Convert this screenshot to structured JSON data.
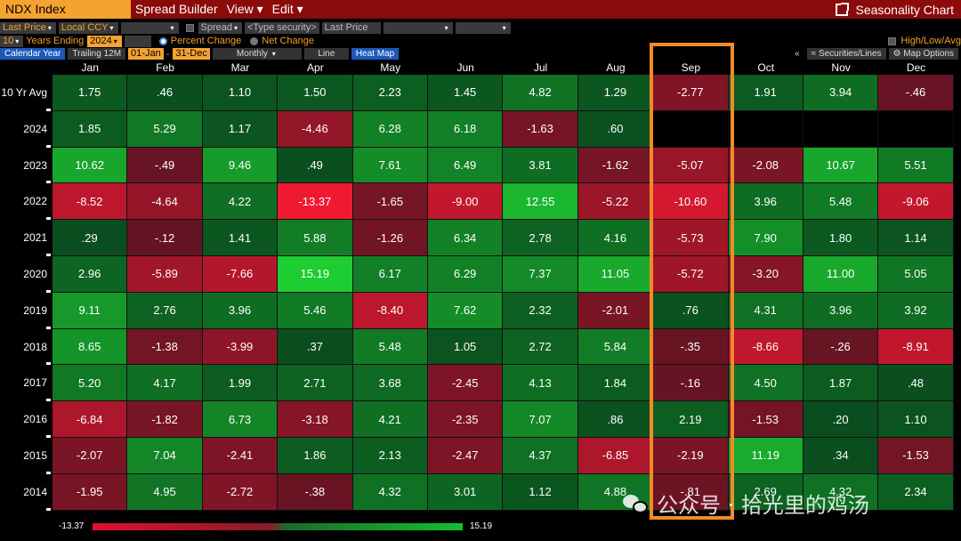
{
  "titlebar": {
    "ticker": "NDX Index",
    "menus": [
      "Spread Builder",
      "View ▾",
      "Edit ▾"
    ],
    "title": "Seasonality Chart"
  },
  "options": {
    "price_field": "Last Price",
    "currency": "Local CCY",
    "spread_label": "Spread",
    "security_placeholder": "<Type security>",
    "second_price": "Last Price",
    "years": "10",
    "years_label": "Years Ending",
    "end_year": "2024",
    "percent_change": "Percent Change",
    "net_change": "Net Change",
    "high_low_avg": "High/Low/Avg"
  },
  "toolbar": {
    "calendar_year": "Calendar Year",
    "trailing": "Trailing 12M",
    "start": "01-Jan",
    "dash": "-",
    "end": "31-Dec",
    "frequency": "Monthly",
    "line": "Line",
    "heat_map": "Heat Map",
    "collapse": "«",
    "securities_lines": "Securities/Lines",
    "map_options": "Map Options"
  },
  "months": [
    "Jan",
    "Feb",
    "Mar",
    "Apr",
    "May",
    "Jun",
    "Jul",
    "Aug",
    "Sep",
    "Oct",
    "Nov",
    "Dec"
  ],
  "rows": [
    {
      "label": "10 Yr Avg",
      "values": [
        "1.75",
        ".46",
        "1.10",
        "1.50",
        "2.23",
        "1.45",
        "4.82",
        "1.29",
        "-2.77",
        "1.91",
        "3.94",
        "-.46"
      ]
    },
    {
      "label": "2024",
      "values": [
        "1.85",
        "5.29",
        "1.17",
        "-4.46",
        "6.28",
        "6.18",
        "-1.63",
        ".60",
        "",
        "",
        "",
        ""
      ]
    },
    {
      "label": "2023",
      "values": [
        "10.62",
        "-.49",
        "9.46",
        ".49",
        "7.61",
        "6.49",
        "3.81",
        "-1.62",
        "-5.07",
        "-2.08",
        "10.67",
        "5.51"
      ]
    },
    {
      "label": "2022",
      "values": [
        "-8.52",
        "-4.64",
        "4.22",
        "-13.37",
        "-1.65",
        "-9.00",
        "12.55",
        "-5.22",
        "-10.60",
        "3.96",
        "5.48",
        "-9.06"
      ]
    },
    {
      "label": "2021",
      "values": [
        ".29",
        "-.12",
        "1.41",
        "5.88",
        "-1.26",
        "6.34",
        "2.78",
        "4.16",
        "-5.73",
        "7.90",
        "1.80",
        "1.14"
      ]
    },
    {
      "label": "2020",
      "values": [
        "2.96",
        "-5.89",
        "-7.66",
        "15.19",
        "6.17",
        "6.29",
        "7.37",
        "11.05",
        "-5.72",
        "-3.20",
        "11.00",
        "5.05"
      ]
    },
    {
      "label": "2019",
      "values": [
        "9.11",
        "2.76",
        "3.96",
        "5.46",
        "-8.40",
        "7.62",
        "2.32",
        "-2.01",
        ".76",
        "4.31",
        "3.96",
        "3.92"
      ]
    },
    {
      "label": "2018",
      "values": [
        "8.65",
        "-1.38",
        "-3.99",
        ".37",
        "5.48",
        "1.05",
        "2.72",
        "5.84",
        "-.35",
        "-8.66",
        "-.26",
        "-8.91"
      ]
    },
    {
      "label": "2017",
      "values": [
        "5.20",
        "4.17",
        "1.99",
        "2.71",
        "3.68",
        "-2.45",
        "4.13",
        "1.84",
        "-.16",
        "4.50",
        "1.87",
        ".48"
      ]
    },
    {
      "label": "2016",
      "values": [
        "-6.84",
        "-1.82",
        "6.73",
        "-3.18",
        "4.21",
        "-2.35",
        "7.07",
        ".86",
        "2.19",
        "-1.53",
        ".20",
        "1.10"
      ]
    },
    {
      "label": "2015",
      "values": [
        "-2.07",
        "7.04",
        "-2.41",
        "1.86",
        "2.13",
        "-2.47",
        "4.37",
        "-6.85",
        "-2.19",
        "11.19",
        ".34",
        "-1.53"
      ]
    },
    {
      "label": "2014",
      "values": [
        "-1.95",
        "4.95",
        "-2.72",
        "-.38",
        "4.32",
        "3.01",
        "1.12",
        "4.88",
        "-.81",
        "2.69",
        "4.32",
        "2.34"
      ]
    }
  ],
  "legend": {
    "min": "-13.37",
    "max": "15.19"
  },
  "watermark": "公众号 · 拾光里的鸡汤",
  "colors": {
    "title_bar": "#8b0a0a",
    "accent": "#f4a331",
    "highlight": "#f28a2a",
    "neg_strong": "#e0102e",
    "pos_strong": "#12c030"
  }
}
